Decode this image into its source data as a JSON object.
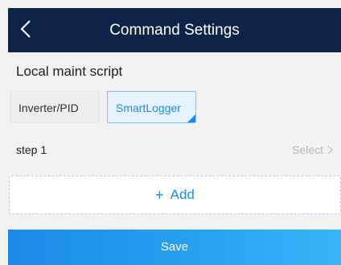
{
  "header": {
    "title": "Command Settings",
    "back_icon": "chevron-left-icon",
    "background": "#0d2448"
  },
  "script": {
    "title": "Local maint script",
    "tabs": [
      {
        "label": "Inverter/PID",
        "selected": false
      },
      {
        "label": "SmartLogger",
        "selected": true
      }
    ]
  },
  "steps": [
    {
      "label": "step 1",
      "value_placeholder": "Select",
      "chevron_icon": "chevron-right-icon"
    }
  ],
  "add": {
    "plus": "+",
    "label": "Add"
  },
  "footer": {
    "save_label": "Save"
  },
  "colors": {
    "accent": "#1e8be6",
    "header": "#0d2448",
    "muted": "#b8b8b8"
  }
}
